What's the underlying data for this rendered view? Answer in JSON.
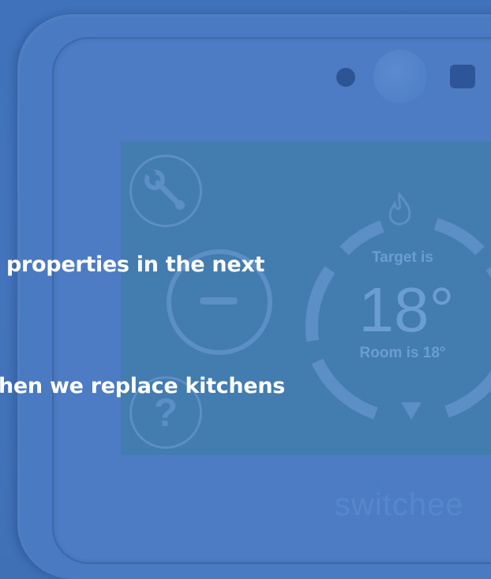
{
  "headline": {
    "line_1": "properties in the next",
    "line_2": "hen we replace kitchens"
  },
  "thermostat": {
    "brand": "switchee",
    "target_label": "Target is",
    "target_value": "18°",
    "room_label": "Room is 18°",
    "buttons": [
      "wrench-icon",
      "minus-icon",
      "help-icon",
      "flame-icon"
    ]
  },
  "colors": {
    "background": "#3f72b9",
    "screen": "#437caf",
    "text": "#ffffff",
    "dial": "#5b8fc6"
  }
}
